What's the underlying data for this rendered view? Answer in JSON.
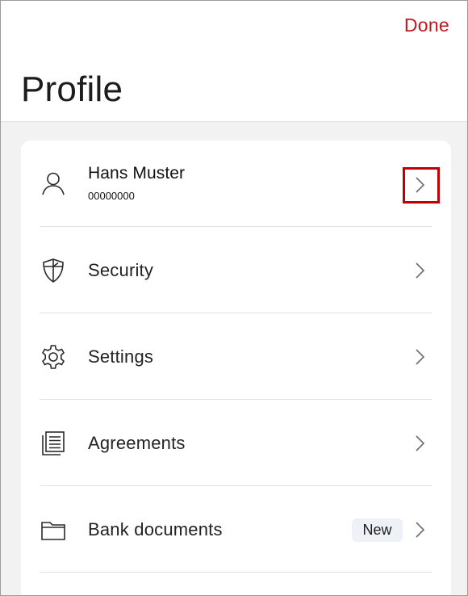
{
  "header": {
    "done_label": "Done",
    "title": "Profile"
  },
  "profile": {
    "name": "Hans Muster",
    "number": "00000000",
    "icon": "person-icon"
  },
  "menu": [
    {
      "label": "Security",
      "icon": "shield-icon"
    },
    {
      "label": "Settings",
      "icon": "gear-icon"
    },
    {
      "label": "Agreements",
      "icon": "document-icon"
    },
    {
      "label": "Bank documents",
      "icon": "folder-icon",
      "badge": "New"
    }
  ],
  "colors": {
    "accent": "#c4161c",
    "highlight_border": "#c00000",
    "background": "#f2f2f2",
    "card": "#ffffff",
    "badge_bg": "#eef1f6"
  }
}
